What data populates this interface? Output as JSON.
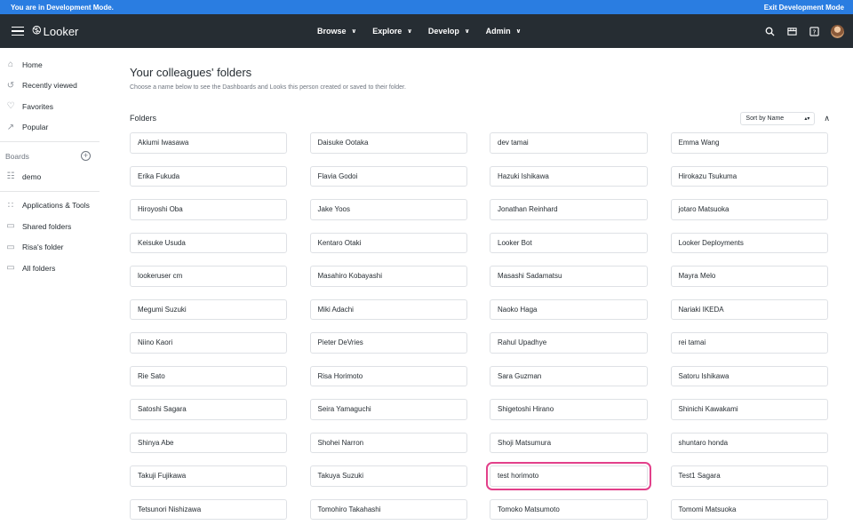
{
  "devbar": {
    "message": "You are in Development Mode.",
    "exit_label": "Exit Development Mode"
  },
  "header": {
    "logo_text": "Looker",
    "menu": [
      {
        "label": "Browse"
      },
      {
        "label": "Explore"
      },
      {
        "label": "Develop"
      },
      {
        "label": "Admin"
      }
    ],
    "icons": [
      "search-icon",
      "marketplace-icon",
      "help-icon",
      "avatar"
    ]
  },
  "sidebar": {
    "nav": [
      {
        "label": "Home",
        "icon": "home-icon"
      },
      {
        "label": "Recently viewed",
        "icon": "history-icon"
      },
      {
        "label": "Favorites",
        "icon": "heart-icon"
      },
      {
        "label": "Popular",
        "icon": "trending-icon"
      }
    ],
    "boards_label": "Boards",
    "boards": [
      {
        "label": "demo",
        "icon": "board-icon"
      }
    ],
    "folders": [
      {
        "label": "Applications & Tools",
        "icon": "apps-grid-icon"
      },
      {
        "label": "Shared folders",
        "icon": "folder-icon"
      },
      {
        "label": "Risa's folder",
        "icon": "folder-icon"
      },
      {
        "label": "All folders",
        "icon": "folder-icon"
      }
    ]
  },
  "main": {
    "title": "Your colleagues' folders",
    "subtitle": "Choose a name below to see the Dashboards and Looks this person created or saved to their folder.",
    "folders_label": "Folders",
    "sort_value": "Sort by Name",
    "highlight_color": "#e2408a",
    "cards": [
      "Akiumi Iwasawa",
      "Daisuke Ootaka",
      "dev tamai",
      "Emma Wang",
      "Erika Fukuda",
      "Flavia Godoi",
      "Hazuki Ishikawa",
      "Hirokazu Tsukuma",
      "Hiroyoshi Oba",
      "Jake Yoos",
      "Jonathan Reinhard",
      "jotaro Matsuoka",
      "Keisuke Usuda",
      "Kentaro Otaki",
      "Looker Bot",
      "Looker Deployments",
      "lookeruser cm",
      "Masahiro Kobayashi",
      "Masashi Sadamatsu",
      "Mayra Melo",
      "Megumi Suzuki",
      "Miki Adachi",
      "Naoko Haga",
      "Nariaki IKEDA",
      "Niino Kaori",
      "Pieter DeVries",
      "Rahul Upadhye",
      "rei tamai",
      "Rie Sato",
      "Risa Horimoto",
      "Sara Guzman",
      "Satoru Ishikawa",
      "Satoshi Sagara",
      "Seira Yamaguchi",
      "Shigetoshi Hirano",
      "Shinichi Kawakami",
      "Shinya Abe",
      "Shohei Narron",
      "Shoji Matsumura",
      "shuntaro honda",
      "Takuji Fujikawa",
      "Takuya Suzuki",
      "test horimoto",
      "Test1 Sagara",
      "Tetsunori Nishizawa",
      "Tomohiro Takahashi",
      "Tomoko Matsumoto",
      "Tomomi Matsuoka"
    ],
    "highlighted_card": "test horimoto"
  }
}
